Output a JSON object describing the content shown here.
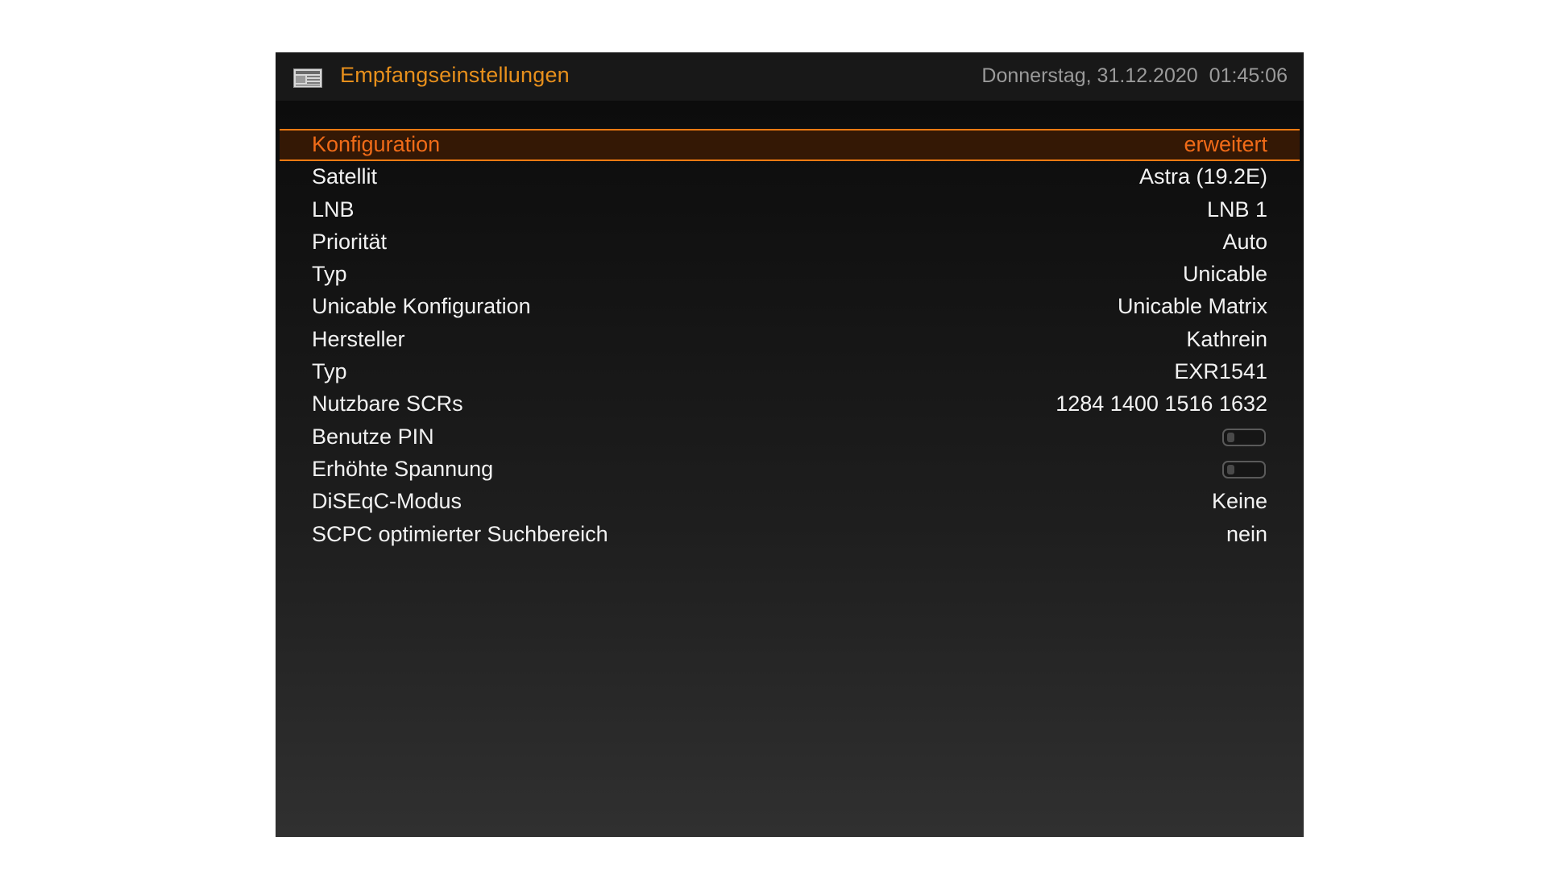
{
  "header": {
    "icon": "newspaper-icon",
    "title": "Empfangseinstellungen",
    "date": "Donnerstag, 31.12.2020",
    "time": "01:45:06"
  },
  "settings": [
    {
      "label": "Konfiguration",
      "value": "erweitert",
      "selected": true
    },
    {
      "label": "Satellit",
      "value": "Astra (19.2E)"
    },
    {
      "label": "LNB",
      "value": "LNB 1"
    },
    {
      "label": "Priorität",
      "value": "Auto"
    },
    {
      "label": "Typ",
      "value": "Unicable"
    },
    {
      "label": "Unicable Konfiguration",
      "value": "Unicable Matrix"
    },
    {
      "label": "Hersteller",
      "value": "Kathrein"
    },
    {
      "label": "Typ",
      "value": "EXR1541"
    },
    {
      "label": "Nutzbare SCRs",
      "value": "1284 1400 1516 1632"
    },
    {
      "label": "Benutze PIN",
      "toggle": "off"
    },
    {
      "label": "Erhöhte Spannung",
      "toggle": "off"
    },
    {
      "label": "DiSEqC-Modus",
      "value": "Keine"
    },
    {
      "label": "SCPC optimierter Suchbereich",
      "value": "nein"
    }
  ],
  "colors": {
    "accent": "#e8901c",
    "selection_text": "#f06b18",
    "selection_border": "#f07a12",
    "selection_bg": "#341805"
  }
}
